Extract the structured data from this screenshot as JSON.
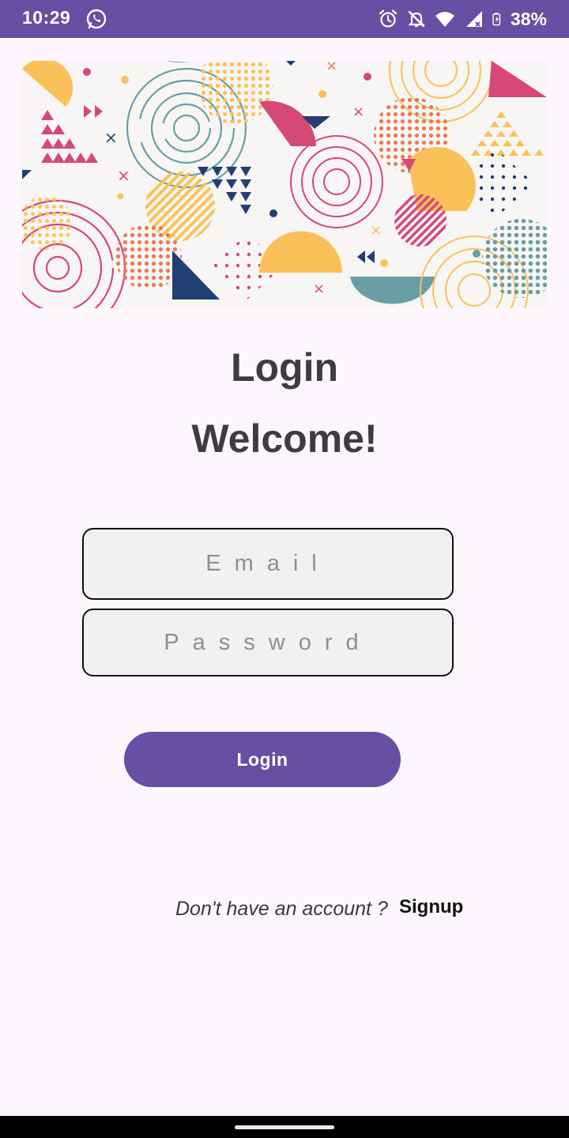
{
  "status_bar": {
    "time": "10:29",
    "battery": "38%",
    "background_color": "#674fa3",
    "icons": [
      "whatsapp-icon",
      "alarm-icon",
      "mute-icon",
      "wifi-icon",
      "signal-icon",
      "battery-icon"
    ]
  },
  "header": {
    "title": "Login",
    "subtitle": "Welcome!"
  },
  "form": {
    "email_placeholder": "Email",
    "password_placeholder": "Password",
    "login_button": "Login"
  },
  "footer": {
    "question": "Don't have an account ?",
    "signup_link": "Signup"
  },
  "colors": {
    "accent": "#674fa3",
    "background": "#fdf7fd",
    "field_background": "#f1f1f1",
    "title_text": "#3e3b45"
  }
}
